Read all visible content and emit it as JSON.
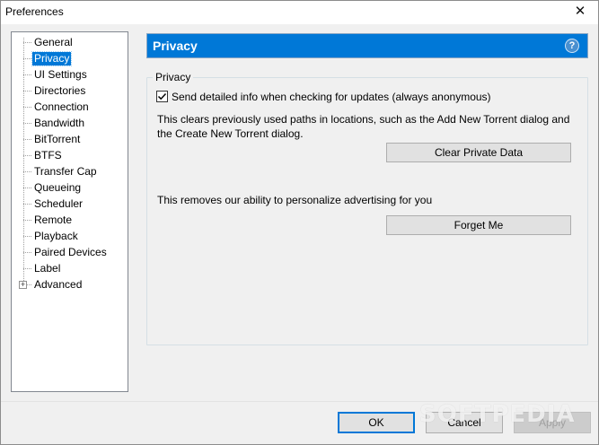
{
  "window": {
    "title": "Preferences",
    "close_glyph": "✕"
  },
  "tree": {
    "items": [
      {
        "label": "General"
      },
      {
        "label": "Privacy",
        "selected": true
      },
      {
        "label": "UI Settings"
      },
      {
        "label": "Directories"
      },
      {
        "label": "Connection"
      },
      {
        "label": "Bandwidth"
      },
      {
        "label": "BitTorrent"
      },
      {
        "label": "BTFS"
      },
      {
        "label": "Transfer Cap"
      },
      {
        "label": "Queueing"
      },
      {
        "label": "Scheduler"
      },
      {
        "label": "Remote"
      },
      {
        "label": "Playback"
      },
      {
        "label": "Paired Devices"
      },
      {
        "label": "Label"
      },
      {
        "label": "Advanced",
        "expandable": true
      }
    ],
    "expander_glyph": "+"
  },
  "header": {
    "title": "Privacy",
    "help_glyph": "?"
  },
  "privacy": {
    "group_label": "Privacy",
    "send_info_checkbox": {
      "label": "Send detailed info when checking for updates (always anonymous)",
      "checked": true
    },
    "clear_text_line1": "This clears previously used paths in locations, such as the Add New Torrent dialog and",
    "clear_text_line2": "the Create New Torrent dialog.",
    "clear_button": "Clear Private Data",
    "personalize_text": "This removes our ability to personalize advertising for you",
    "forget_button": "Forget Me"
  },
  "footer": {
    "ok": "OK",
    "cancel": "Cancel",
    "apply": "Apply"
  },
  "watermark": "SOFTPEDIA",
  "colors": {
    "accent": "#0078d7",
    "window_bg": "#f0f0f0"
  }
}
